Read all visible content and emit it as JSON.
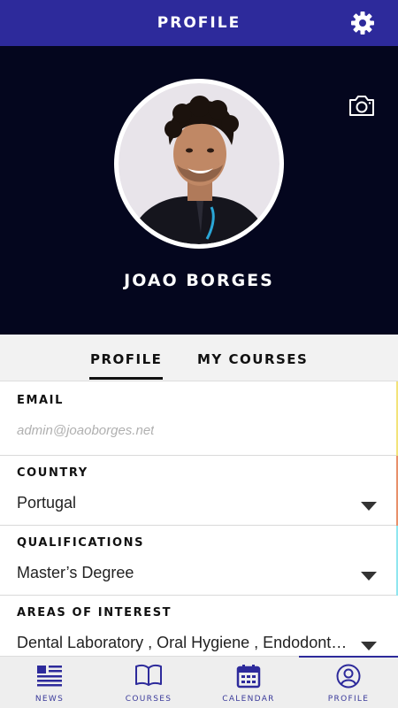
{
  "header": {
    "title": "PROFILE",
    "settings_icon": "gear-icon"
  },
  "profile": {
    "name": "JOAO BORGES",
    "camera_icon": "camera-icon"
  },
  "tabs": [
    {
      "label": "PROFILE",
      "active": true
    },
    {
      "label": "MY COURSES",
      "active": false
    }
  ],
  "fields": {
    "email": {
      "label": "EMAIL",
      "placeholder": "admin@joaoborges.net"
    },
    "country": {
      "label": "COUNTRY",
      "value": "Portugal"
    },
    "qualifications": {
      "label": "QUALIFICATIONS",
      "value": "Master’s Degree"
    },
    "interests": {
      "label": "AREAS OF INTEREST",
      "value": "Dental Laboratory , Oral Hygiene , Endodont…"
    }
  },
  "bottom_nav": [
    {
      "label": "NEWS",
      "icon": "news-icon"
    },
    {
      "label": "COURSES",
      "icon": "book-icon"
    },
    {
      "label": "CALENDAR",
      "icon": "calendar-icon"
    },
    {
      "label": "PROFILE",
      "icon": "user-circle-icon",
      "active": true
    }
  ],
  "colors": {
    "primary": "#2d2a9b",
    "hero_bg": "#04061e"
  }
}
